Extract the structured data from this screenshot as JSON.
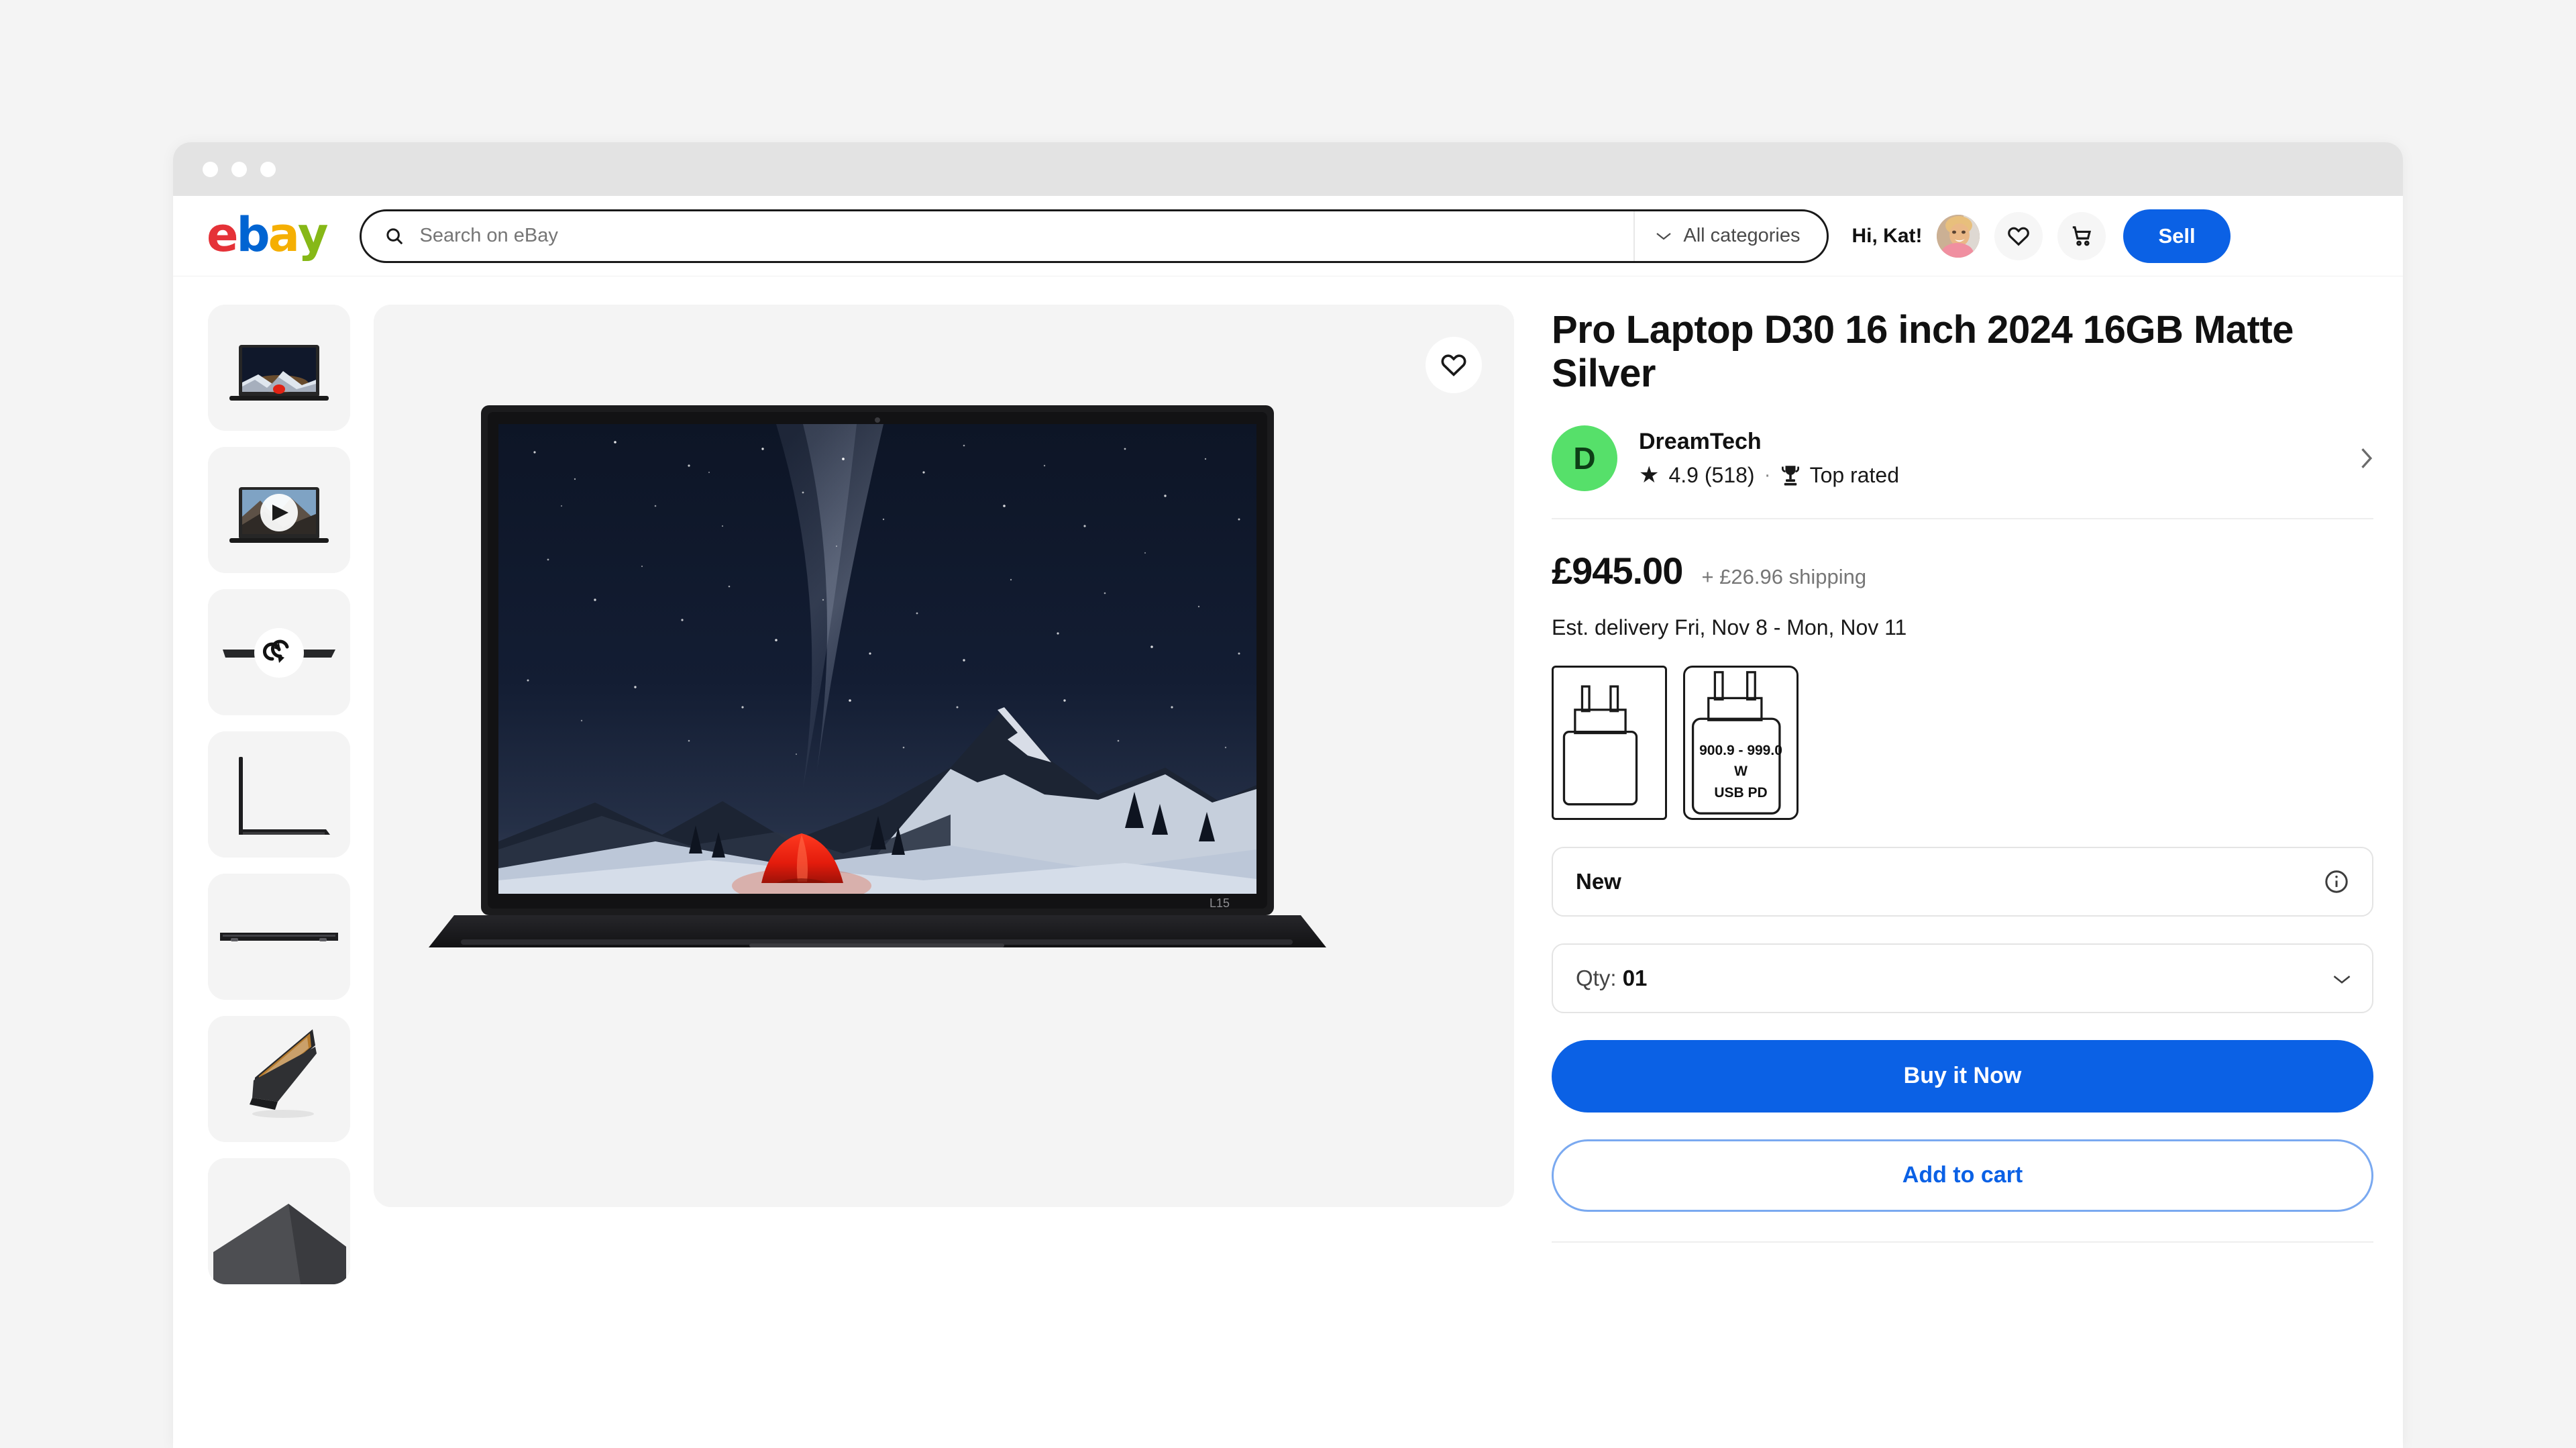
{
  "window": {
    "dots": [
      "dot-red",
      "dot-yellow",
      "dot-green"
    ]
  },
  "header": {
    "logo_letters": [
      "e",
      "b",
      "a",
      "y"
    ],
    "logo_alt": "ebay",
    "search": {
      "placeholder": "Search on eBay",
      "value": "",
      "icon": "search-icon"
    },
    "category_select": {
      "label": "All categories",
      "icon": "chevron-down-icon"
    },
    "greeting": "Hi, Kat!",
    "avatar_alt": "user-avatar",
    "watchlist_icon": "heart-icon",
    "cart_icon": "shopping-cart-icon",
    "sell_label": "Sell"
  },
  "gallery": {
    "watch_icon": "heart-icon",
    "main_image_alt": "laptop-night-sky-wallpaper",
    "model_badge": "L15",
    "thumbnails": [
      {
        "name": "thumb-front-open",
        "type": "image",
        "active": true
      },
      {
        "name": "thumb-video",
        "type": "video",
        "overlay_icon": "play-icon"
      },
      {
        "name": "thumb-360",
        "type": "rotate",
        "overlay_icon": "rotate-360-icon"
      },
      {
        "name": "thumb-side-open",
        "type": "image"
      },
      {
        "name": "thumb-closed-edge",
        "type": "image"
      },
      {
        "name": "thumb-tilted-open",
        "type": "image"
      },
      {
        "name": "thumb-dark-wedge",
        "type": "image"
      }
    ]
  },
  "product": {
    "title": "Pro Laptop D30 16 inch 2024 16GB Matte Silver",
    "seller": {
      "initial": "D",
      "name": "DreamTech",
      "rating": "4.9 (518)",
      "star_icon": "star-icon",
      "separator": "·",
      "badge_icon": "trophy-icon",
      "badge_label": "Top rated",
      "chevron_icon": "chevron-right-icon"
    },
    "price": "£945.00",
    "shipping": "+ £26.96 shipping",
    "delivery": "Est. delivery Fri, Nov 8 - Mon, Nov 11",
    "variants": [
      {
        "name": "charger-plain",
        "label": "",
        "selected": true
      },
      {
        "name": "charger-usb-pd",
        "label": "900.9 - 999.0\nW\nUSB PD",
        "line1": "900.9 - 999.0",
        "line2": "W",
        "line3": "USB PD",
        "selected": false
      }
    ],
    "condition": {
      "value": "New",
      "info_icon": "info-circle-icon"
    },
    "quantity": {
      "prefix": "Qty:",
      "value": "01",
      "icon": "chevron-down-icon"
    },
    "buy_now_label": "Buy it Now",
    "add_to_cart_label": "Add to cart"
  },
  "colors": {
    "brand_blue": "#0b61e5",
    "ebay_red": "#e53238",
    "ebay_blue": "#0064d2",
    "ebay_yellow": "#f5af02",
    "ebay_green": "#86b817",
    "seller_avatar_green": "#56e06a",
    "page_bg": "#f4f4f4",
    "muted_text": "#767676"
  }
}
